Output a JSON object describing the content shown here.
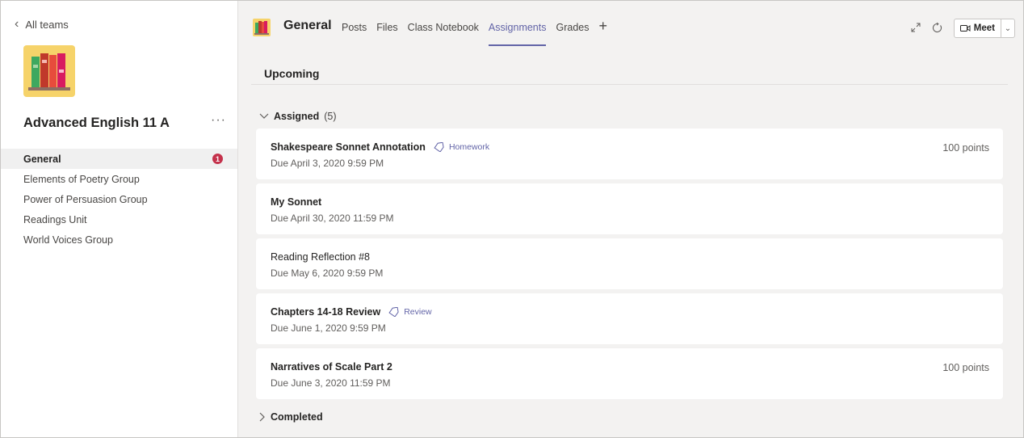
{
  "sidebar": {
    "back_label": "All teams",
    "team_name": "Advanced English 11 A",
    "more_label": "···",
    "channels": [
      {
        "label": "General",
        "badge": "1"
      },
      {
        "label": "Elements of Poetry Group"
      },
      {
        "label": "Power of Persuasion Group"
      },
      {
        "label": "Readings Unit"
      },
      {
        "label": "World Voices Group"
      }
    ]
  },
  "header": {
    "channel_title": "General",
    "tabs": [
      "Posts",
      "Files",
      "Class Notebook",
      "Assignments",
      "Grades"
    ],
    "active_tab": "Assignments",
    "add_tab_label": "+",
    "meet_label": "Meet"
  },
  "main": {
    "section_title": "Upcoming",
    "assigned_label": "Assigned",
    "assigned_count": "(5)",
    "completed_label": "Completed",
    "assignments": [
      {
        "title": "Shakespeare Sonnet Annotation",
        "tag": "Homework",
        "due": "Due April 3, 2020 9:59 PM",
        "points": "100 points"
      },
      {
        "title": "My Sonnet",
        "due": "Due April 30, 2020 11:59 PM"
      },
      {
        "title": "Reading Reflection #8",
        "due": "Due May 6, 2020 9:59 PM"
      },
      {
        "title": "Chapters 14-18 Review",
        "tag": "Review",
        "due": "Due June 1, 2020 9:59 PM"
      },
      {
        "title": "Narratives of Scale Part 2",
        "due": "Due June 3, 2020 11:59 PM",
        "points": "100 points"
      }
    ]
  },
  "colors": {
    "accent": "#6264a7",
    "badge": "#c4314b",
    "logo_bg": "#f6d36a",
    "main_bg": "#f3f2f1"
  }
}
